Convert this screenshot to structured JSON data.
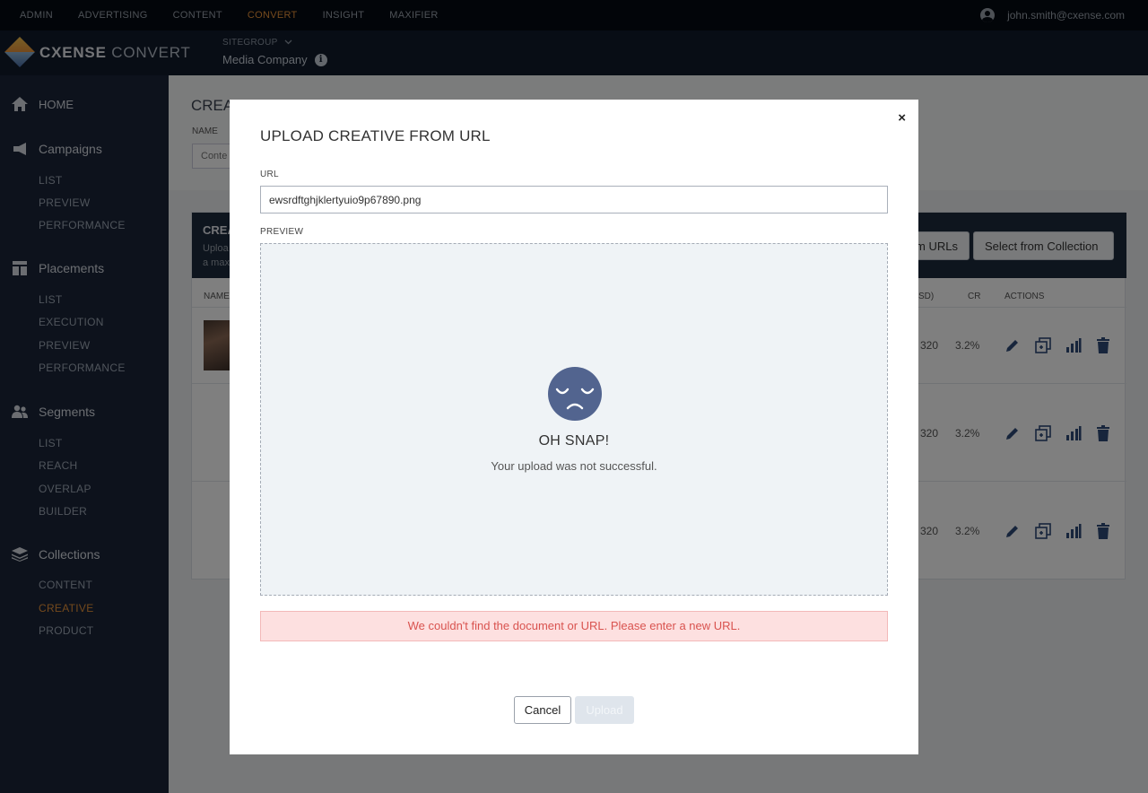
{
  "topnav": {
    "items": [
      {
        "label": "ADMIN"
      },
      {
        "label": "ADVERTISING"
      },
      {
        "label": "CONTENT"
      },
      {
        "label": "CONVERT",
        "active": true
      },
      {
        "label": "INSIGHT"
      },
      {
        "label": "MAXIFIER"
      }
    ],
    "user_email": "john.smith@cxense.com"
  },
  "brand": {
    "name_bold": "CXENSE",
    "name_light": "CONVERT",
    "sitegroup_label": "SITEGROUP",
    "sitegroup_value": "Media Company"
  },
  "sidebar": {
    "home": "HOME",
    "campaigns": {
      "label": "Campaigns",
      "items": [
        "LIST",
        "PREVIEW",
        "PERFORMANCE"
      ]
    },
    "placements": {
      "label": "Placements",
      "items": [
        "LIST",
        "EXECUTION",
        "PREVIEW",
        "PERFORMANCE"
      ]
    },
    "segments": {
      "label": "Segments",
      "items": [
        "LIST",
        "REACH",
        "OVERLAP",
        "BUILDER"
      ]
    },
    "collections": {
      "label": "Collections",
      "items": [
        "CONTENT",
        "CREATIVE",
        "PRODUCT"
      ],
      "active_item": "CREATIVE"
    }
  },
  "page": {
    "title": "CREA",
    "name_label": "NAME",
    "name_value": "Conte",
    "panel_title": "CREA",
    "panel_sub_1": "Uploa",
    "panel_sub_2": "a max",
    "btn_urls": "m URLs",
    "btn_collection": "Select from Collection",
    "columns": {
      "name": "NAME",
      "usd": "SD)",
      "cr": "CR",
      "actions": "ACTIONS"
    },
    "rows": [
      {
        "usd": "320",
        "cr": "3.2%"
      },
      {
        "usd": "320",
        "cr": "3.2%"
      },
      {
        "usd": "320",
        "cr": "3.2%"
      }
    ]
  },
  "modal": {
    "title": "UPLOAD CREATIVE FROM URL",
    "close_symbol": "×",
    "url_label": "URL",
    "url_value": "ewsrdftghjklertyuio9p67890.png",
    "preview_label": "PREVIEW",
    "error_title": "OH SNAP!",
    "error_subtitle": "Your upload was not successful.",
    "error_message": "We couldn't find the document or URL. Please enter a new URL.",
    "cancel_label": "Cancel",
    "upload_label": "Upload"
  },
  "colors": {
    "accent": "#e8933a",
    "navy": "#1a2538",
    "error_bg": "#fde0e0",
    "error_text": "#d9534f",
    "face": "#52648f"
  }
}
